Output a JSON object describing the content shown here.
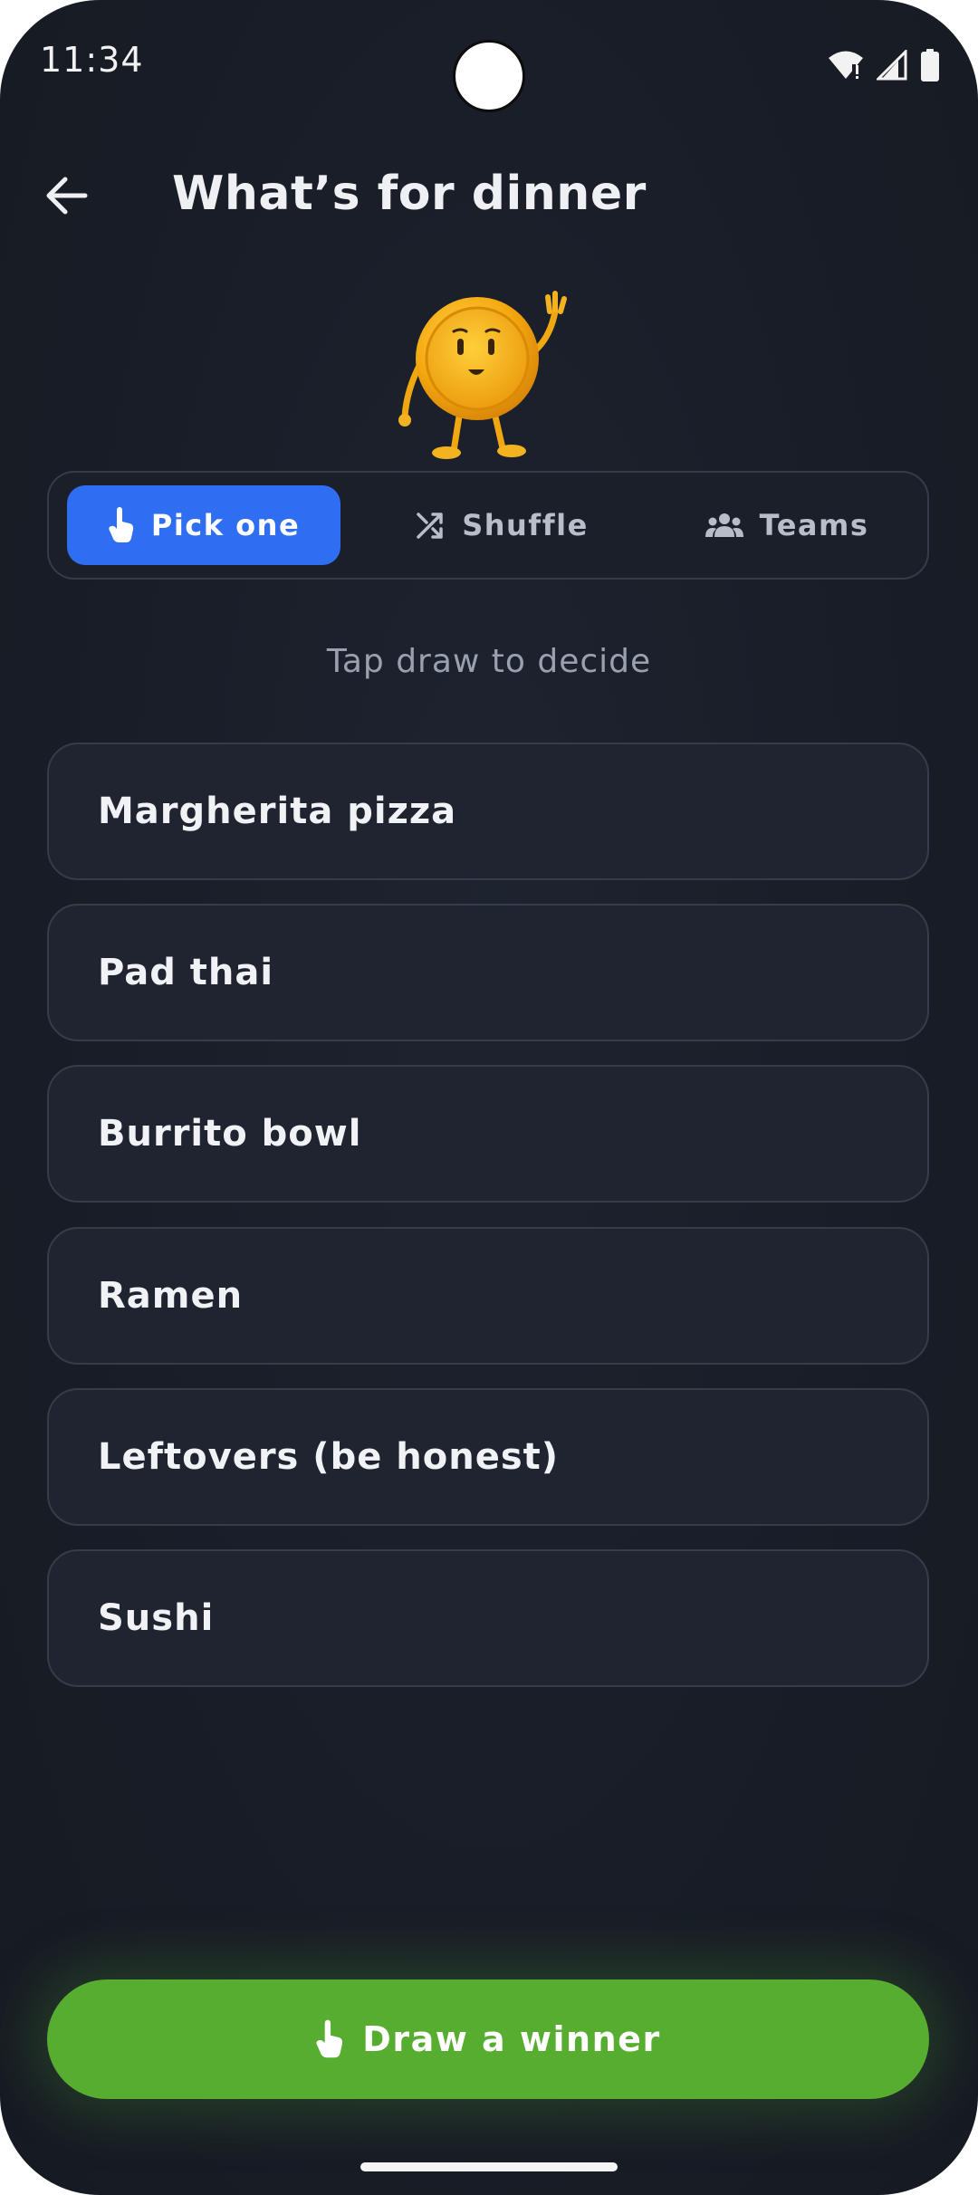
{
  "status_bar": {
    "time": "11:34"
  },
  "header": {
    "title": "What’s for dinner"
  },
  "mode_tabs": [
    {
      "label": "Pick one",
      "icon": "pointer-hand-icon",
      "active": true
    },
    {
      "label": "Shuffle",
      "icon": "shuffle-icon",
      "active": false
    },
    {
      "label": "Teams",
      "icon": "group-icon",
      "active": false
    }
  ],
  "hint": "Tap draw to decide",
  "options": [
    "Margherita pizza",
    "Pad thai",
    "Burrito bowl",
    "Ramen",
    "Leftovers (be honest)",
    "Sushi"
  ],
  "draw_button": {
    "label": "Draw a winner",
    "icon": "pointer-hand-icon"
  },
  "colors": {
    "accent_blue": "#2f6ef0",
    "accent_green": "#56ad2f",
    "background": "#191d27"
  }
}
